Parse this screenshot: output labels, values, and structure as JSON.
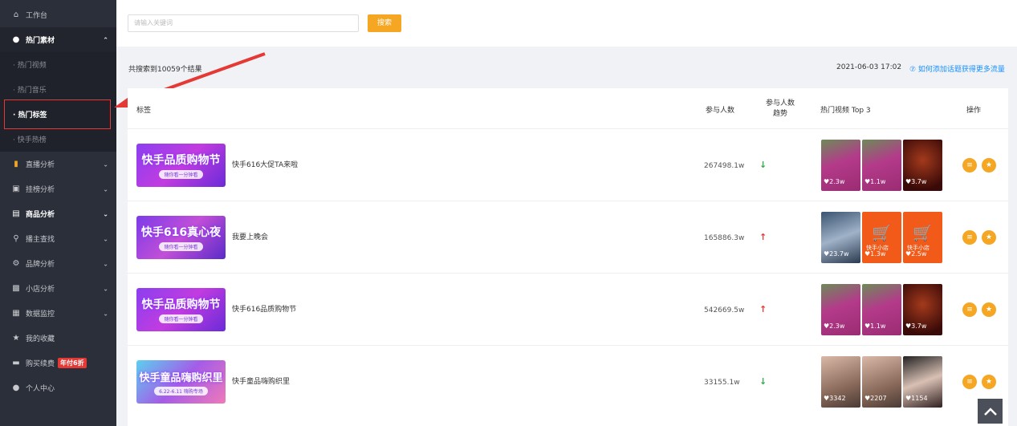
{
  "sidebar": {
    "items": [
      {
        "label": "工作台",
        "icon": "home-icon"
      },
      {
        "label": "热门素材",
        "icon": "fire-icon"
      },
      {
        "label": "直播分析",
        "icon": "bar-chart-icon"
      },
      {
        "label": "挂榜分析",
        "icon": "image-icon"
      },
      {
        "label": "商品分析",
        "icon": "bag-icon"
      },
      {
        "label": "播主查找",
        "icon": "search-icon"
      },
      {
        "label": "品牌分析",
        "icon": "brand-icon"
      },
      {
        "label": "小店分析",
        "icon": "shop-icon"
      },
      {
        "label": "数据监控",
        "icon": "monitor-icon"
      },
      {
        "label": "我的收藏",
        "icon": "star-icon"
      },
      {
        "label": "购买续费",
        "icon": "card-icon",
        "badge": "年付6折"
      },
      {
        "label": "个人中心",
        "icon": "user-icon"
      }
    ],
    "sub_items": [
      "· 热门视频",
      "· 热门音乐",
      "· 热门标签",
      "· 快手热榜"
    ]
  },
  "search": {
    "placeholder": "请输入关键词",
    "button_label": "搜索"
  },
  "info": {
    "count": "共搜索到10059个结果",
    "date": "2021-06-03 17:02",
    "help": "⑦ 如何添加话题获得更多流量"
  },
  "table": {
    "headers": {
      "tag": "标签",
      "participants": "参与人数",
      "trend": "参与人数\n趋势",
      "top_videos": "热门视频 Top 3",
      "ops": "操作"
    },
    "rows": [
      {
        "banner_title": "快手品质购物节",
        "banner_sub": "随你看一分钟看",
        "name": "快手616大促TA来啦",
        "participants": "267498.1w",
        "trend": "down",
        "videos": [
          {
            "views": "2.3w"
          },
          {
            "views": "1.1w"
          },
          {
            "views": "3.7w"
          }
        ]
      },
      {
        "banner_title": "快手616真心夜",
        "banner_sub": "随你看一分钟看",
        "name": "我要上晚会",
        "participants": "165886.3w",
        "trend": "up",
        "videos": [
          {
            "views": "23.7w"
          },
          {
            "views": "1.3w",
            "label": "快手小店"
          },
          {
            "views": "2.5w",
            "label": "快手小店"
          }
        ]
      },
      {
        "banner_title": "快手品质购物节",
        "banner_sub": "随你看一分钟看",
        "name": "快手616品质购物节",
        "participants": "542669.5w",
        "trend": "up",
        "videos": [
          {
            "views": "2.3w"
          },
          {
            "views": "1.1w"
          },
          {
            "views": "3.7w"
          }
        ]
      },
      {
        "banner_title": "快手童品嗨购织里",
        "banner_sub": "6.22-6.11 嗨购专场",
        "name": "快手童品嗨购织里",
        "participants": "33155.1w",
        "trend": "down",
        "videos": [
          {
            "views": "3342"
          },
          {
            "views": "2207"
          },
          {
            "views": "1154"
          }
        ]
      }
    ]
  },
  "colors": {
    "accent": "#f5a623",
    "sidebar_bg": "#2b2f3a",
    "highlight": "#e53935",
    "link": "#1890ff",
    "up": "#e53935",
    "down": "#2eaa4a"
  }
}
